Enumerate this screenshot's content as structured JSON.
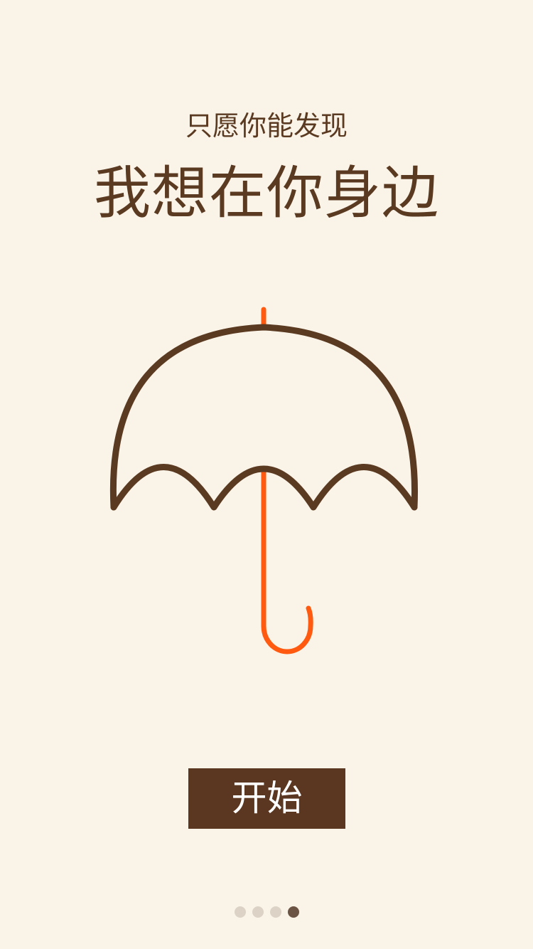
{
  "intro": {
    "subtitle": "只愿你能发现",
    "title": "我想在你身边"
  },
  "illustration": {
    "icon": "umbrella-icon",
    "canopy_color": "#5B3A22",
    "handle_color": "#FF5A0F"
  },
  "actions": {
    "start_label": "开始"
  },
  "pager": {
    "total": 4,
    "current": 4
  },
  "colors": {
    "background": "#FAF4E8",
    "text": "#5B3A22",
    "button": "#5B3620",
    "dot_inactive": "#DCD3C6",
    "dot_active": "#6B5444"
  }
}
